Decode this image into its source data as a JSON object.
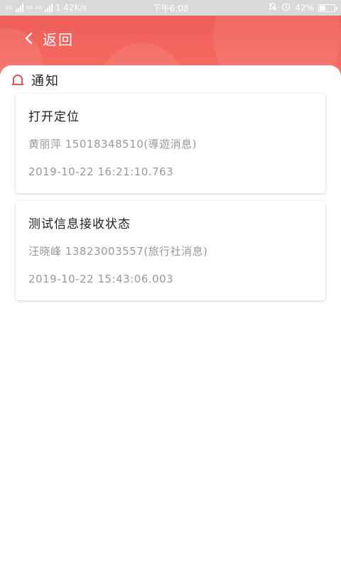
{
  "status_bar": {
    "net_speed": "1.42K/s",
    "time": "下午6:08",
    "battery": "42%",
    "battery_level": 0.42,
    "net_tag_1": "2G",
    "net_tag_2": "4G 4G"
  },
  "nav": {
    "back_label": "返回"
  },
  "section": {
    "title": "通知"
  },
  "notifications": [
    {
      "title": "打开定位",
      "sender": "黄丽萍 15018348510(導遊消息)",
      "time": "2019-10-22 16:21:10.763"
    },
    {
      "title": "测试信息接收状态",
      "sender": "汪晓峰 13823003557(旅行社消息)",
      "time": "2019-10-22 15:43:06.003"
    }
  ],
  "colors": {
    "header": "#ee5a56",
    "accent_icon": "#e0555a"
  }
}
